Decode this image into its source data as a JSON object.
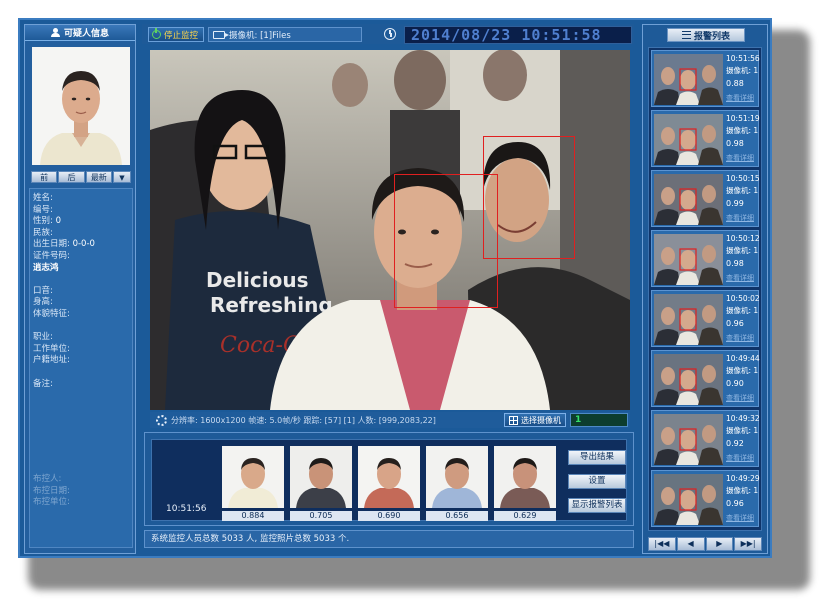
{
  "left_panel": {
    "title": "可疑人信息",
    "nav": {
      "prev": "前",
      "next": "后",
      "latest": "最新",
      "dropdown": "▼"
    },
    "fields": [
      {
        "label": "姓名:",
        "value": ""
      },
      {
        "label": "编号:",
        "value": ""
      },
      {
        "label": "性别:",
        "value": "0"
      },
      {
        "label": "民族:",
        "value": ""
      },
      {
        "label": "出生日期:",
        "value": "0-0-0"
      },
      {
        "label": "证件号码:",
        "value": ""
      }
    ],
    "name_value": "逍志鸿",
    "fields2": [
      {
        "label": "口音:"
      },
      {
        "label": "身高:"
      },
      {
        "label": "体貌特征:"
      }
    ],
    "fields3": [
      {
        "label": "职业:"
      },
      {
        "label": "工作单位:"
      },
      {
        "label": "户籍地址:"
      }
    ],
    "remark_label": "备注:",
    "footer": [
      "布控人:",
      "布控日期:",
      "布控单位:"
    ]
  },
  "topbar": {
    "stop_label": "停止监控",
    "camera_label": "摄像机: [1]Files",
    "datetime": "2014/08/23 10:51:58"
  },
  "video_info": {
    "text": "分辨率: 1600x1200 帧速: 5.0帧/秒  跟踪: [57]  [1]  人数: [999,2083,22]",
    "select_camera": "选择摄像机",
    "page": "1"
  },
  "match_strip": {
    "capture_time": "10:51:56",
    "matches": [
      {
        "score": "0.884",
        "shirt": "#f1ecd6",
        "skin": "#d9a98a"
      },
      {
        "score": "0.705",
        "shirt": "#3c3f48",
        "skin": "#c99378"
      },
      {
        "score": "0.690",
        "shirt": "#c46a58",
        "skin": "#d8a488"
      },
      {
        "score": "0.656",
        "shirt": "#9fb6d8",
        "skin": "#cf9b80"
      },
      {
        "score": "0.629",
        "shirt": "#7a5b56",
        "skin": "#c8927a"
      }
    ],
    "buttons": {
      "export": "导出结果",
      "settings": "设置",
      "show_alarms": "显示报警列表"
    }
  },
  "status_bar": {
    "text": "系统监控人员总数 5033 人, 监控照片总数 5033 个."
  },
  "right_panel": {
    "title": "报警列表",
    "alarms": [
      {
        "time": "10:51:56",
        "camera": "摄像机: 1",
        "score": "0.88",
        "link": "查看详细"
      },
      {
        "time": "10:51:19",
        "camera": "摄像机: 1",
        "score": "0.98",
        "link": "查看详细"
      },
      {
        "time": "10:50:15",
        "camera": "摄像机: 1",
        "score": "0.99",
        "link": "查看详细"
      },
      {
        "time": "10:50:12",
        "camera": "摄像机: 1",
        "score": "0.98",
        "link": "查看详细"
      },
      {
        "time": "10:50:02",
        "camera": "摄像机: 1",
        "score": "0.96",
        "link": "查看详细"
      },
      {
        "time": "10:49:44",
        "camera": "摄像机: 1",
        "score": "0.90",
        "link": "查看详细"
      },
      {
        "time": "10:49:32",
        "camera": "摄像机: 1",
        "score": "0.92",
        "link": "查看详细"
      },
      {
        "time": "10:49:29",
        "camera": "摄像机: 1",
        "score": "0.96",
        "link": "查看详细"
      }
    ],
    "pager": {
      "first": "|◀◀",
      "prev": "◀",
      "next": "▶",
      "last": "▶▶|"
    }
  },
  "video_overlay": {
    "shirt_text_line1": "Delicious",
    "shirt_text_line2": "Refreshing",
    "shirt_text_line3": "Coca-Cola"
  },
  "colors": {
    "panel_blue": "#1b5a99",
    "face_box_red": "#e02020",
    "clock_text": "#4f7fcf",
    "stop_text": "#ffd84a"
  }
}
